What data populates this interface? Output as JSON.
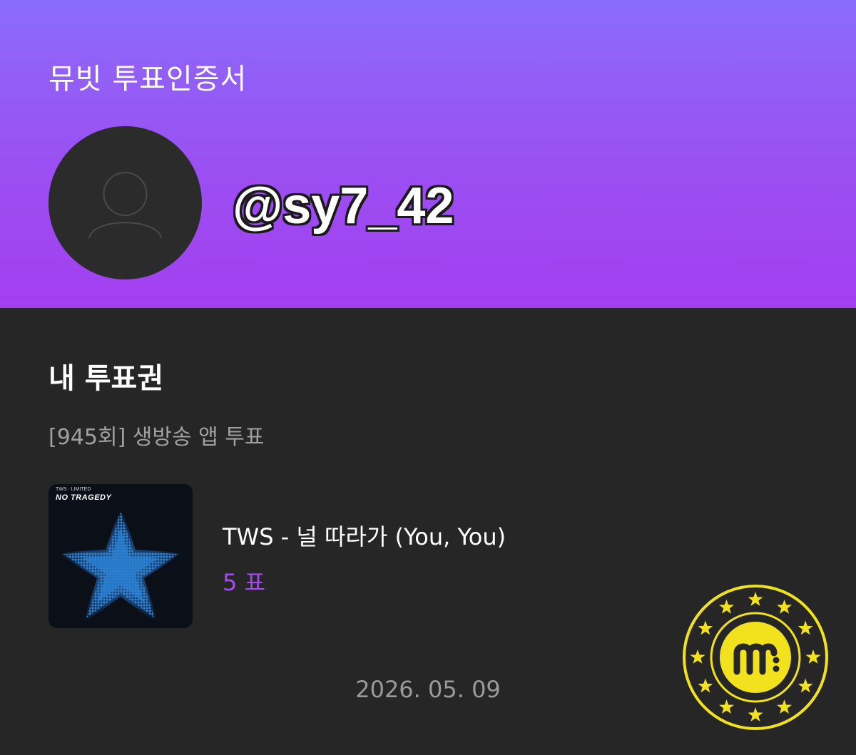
{
  "header": {
    "title": "뮤빗 투표인증서",
    "username": "@sy7_42",
    "avatar_icon": "user-silhouette-icon"
  },
  "vote_section": {
    "title": "내 투표권",
    "episode": "[945회] 생방송 앱 투표"
  },
  "entry": {
    "album_label": "NO TRAGEDY",
    "song": "TWS - 널 따라가 (You, You)",
    "votes": "5 표"
  },
  "footer": {
    "date": "2026. 05. 09",
    "seal_icon": "mubeat-seal-icon"
  },
  "colors": {
    "header_top": "#8b6cfa",
    "header_bottom": "#a33ff0",
    "background": "#262626",
    "vote_accent": "#a64bf0",
    "seal": "#f2e21e"
  }
}
